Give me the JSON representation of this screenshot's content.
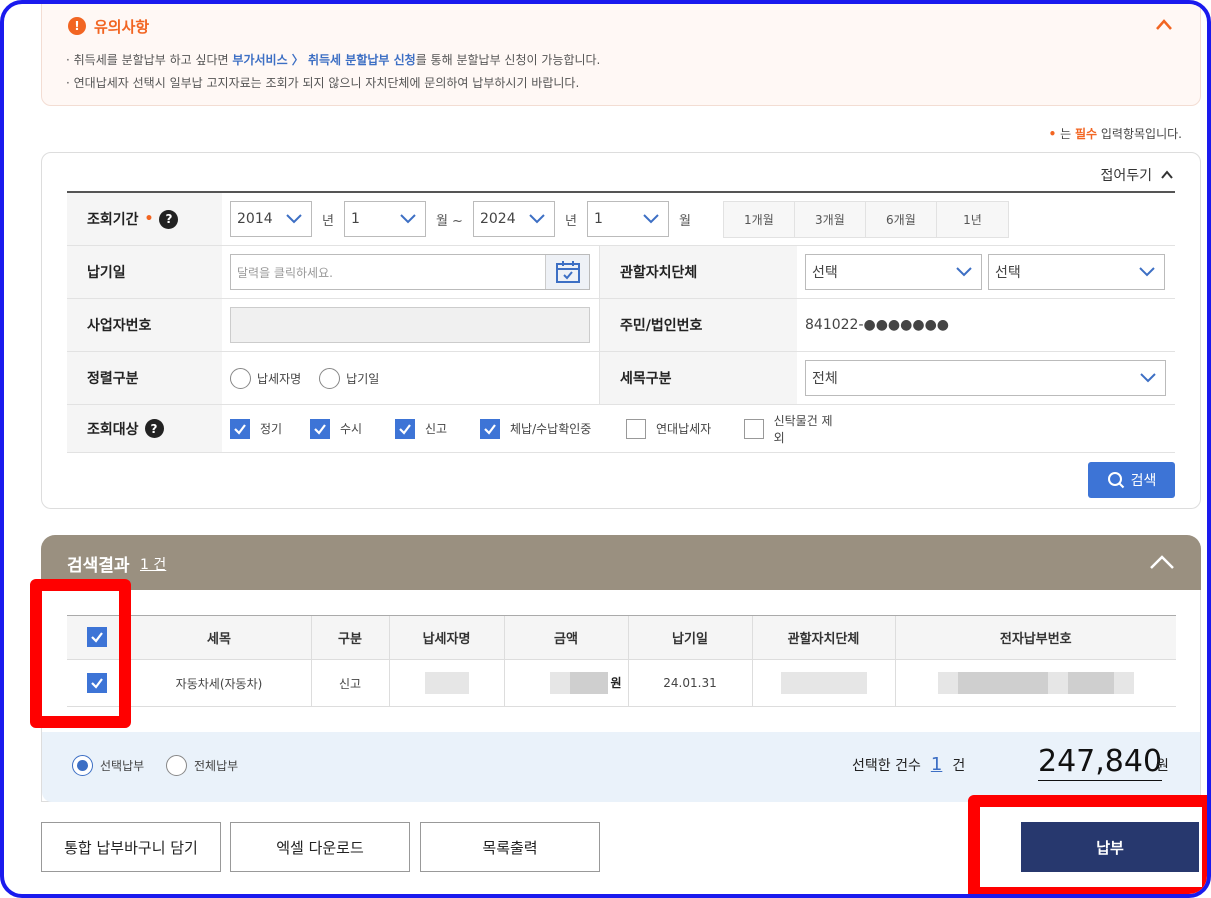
{
  "notice": {
    "title": "유의사항",
    "line1_pre": "· 취득세를 분할납부 하고 싶다면 ",
    "line1_link": "부가서비스 〉 취득세 분할납부 신청",
    "line1_post": "를 통해 분할납부 신청이 가능합니다.",
    "line2": "· 연대납세자 선택시 일부납 고지자료는 조회가 되지 않으니 자치단체에 문의하여 납부하시기 바랍니다."
  },
  "required_note": {
    "dot": "•",
    "mid": " 는 ",
    "req": "필수",
    "post": " 입력항목입니다."
  },
  "search": {
    "fold_label": "접어두기",
    "period": {
      "label": "조회기간",
      "from_year": "2014",
      "from_month": "1",
      "to_year": "2024",
      "to_month": "1",
      "year_unit": "년",
      "month_unit_range": "월 ~",
      "month_unit": "월",
      "quick": [
        "1개월",
        "3개월",
        "6개월",
        "1년"
      ]
    },
    "pay_date": {
      "label": "납기일",
      "placeholder": "달력을 클릭하세요."
    },
    "local_gov": {
      "label": "관할자치단체",
      "select1": "선택",
      "select2": "선택"
    },
    "biz_no": {
      "label": "사업자번호"
    },
    "resident_no": {
      "label": "주민/법인번호",
      "value": "841022-●●●●●●●"
    },
    "sort": {
      "label": "정렬구분",
      "options": [
        "납세자명",
        "납기일"
      ]
    },
    "tax_type": {
      "label": "세목구분",
      "value": "전체"
    },
    "target": {
      "label": "조회대상",
      "options": [
        {
          "label": "정기",
          "checked": true
        },
        {
          "label": "수시",
          "checked": true
        },
        {
          "label": "신고",
          "checked": true
        },
        {
          "label": "체납/수납확인중",
          "checked": true
        },
        {
          "label": "연대납세자",
          "checked": false
        },
        {
          "label": "신탁물건 제외",
          "checked": false
        }
      ]
    },
    "search_button": "검색"
  },
  "result": {
    "title": "검색결과",
    "count": "1 건",
    "columns": [
      "세목",
      "구분",
      "납세자명",
      "금액",
      "납기일",
      "관할자치단체",
      "전자납부번호"
    ],
    "rows": [
      {
        "tax": "자동차세(자동차)",
        "type": "신고",
        "amount_unit": "원",
        "due": "24.01.31"
      }
    ],
    "pay_options": [
      "선택납부",
      "전체납부"
    ],
    "selected_label": "선택한 건수",
    "selected_count": "1",
    "selected_unit": "건",
    "total": "247,840",
    "total_unit": "원"
  },
  "buttons": {
    "cart": "통합 납부바구니 담기",
    "excel": "엑셀 다운로드",
    "print": "목록출력",
    "pay": "납부"
  },
  "colors": {
    "accent": "#3d74d6",
    "notice": "#f26522",
    "result_header": "#9a9080",
    "pay_button": "#27386e",
    "highlight": "#ff0000",
    "frame": "#1a1aee"
  }
}
